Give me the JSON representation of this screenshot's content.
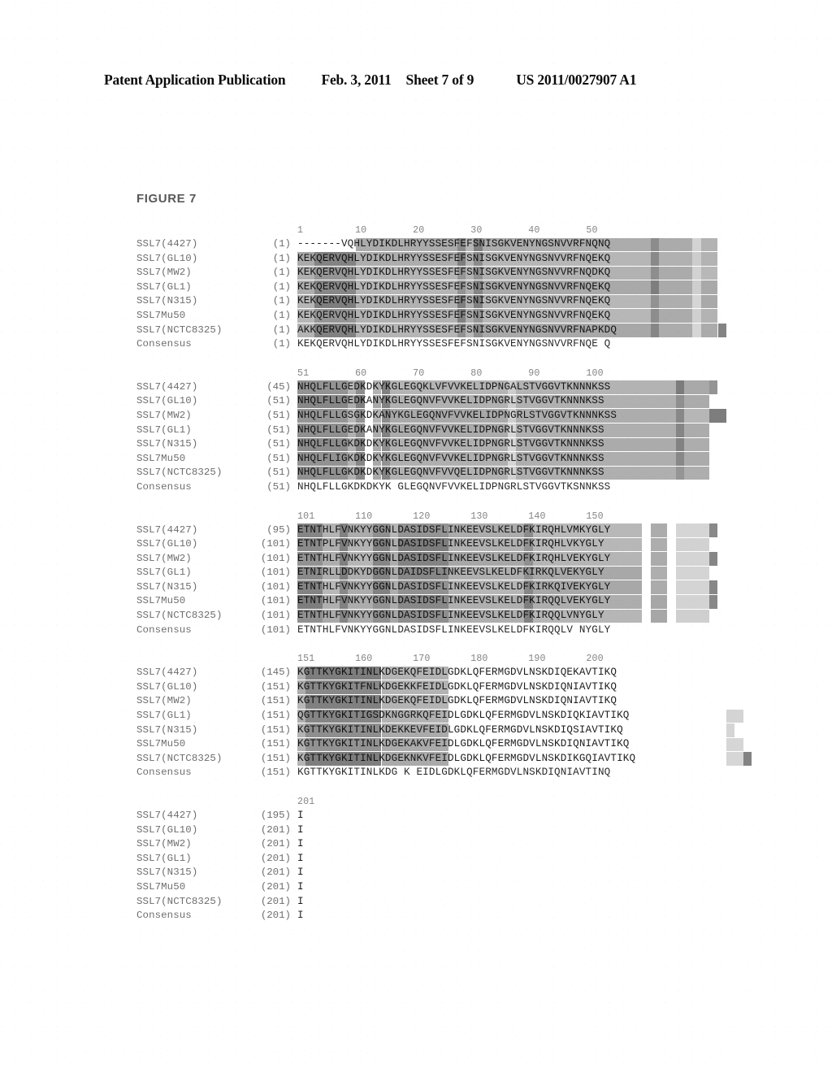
{
  "header": {
    "publication": "Patent Application Publication",
    "date": "Feb. 3, 2011",
    "sheet": "Sheet 7 of 9",
    "patent_number": "US 2011/0027907 A1"
  },
  "figure": {
    "title": "FIGURE 7",
    "row_labels": [
      "SSL7(4427)",
      "SSL7(GL10)",
      "SSL7(MW2)",
      "SSL7(GL1)",
      "SSL7(N315)",
      "SSL7Mu50",
      "SSL7(NCTC8325)",
      "Consensus"
    ],
    "blocks": [
      {
        "ruler": "1         10        20        30        40        50",
        "positions": [
          "(1)",
          "(1)",
          "(1)",
          "(1)",
          "(1)",
          "(1)",
          "(1)",
          "(1)"
        ],
        "sequences": [
          "-------VQHLYDIKDLHRYYSSESFEFSNISGKVENYNGSNVVRFNQNQ",
          "KEKQERVQHLYDIKDLHRYYSSESFEFSNISGKVENYNGSNVVRFNQEKQ",
          "KEKQERVQHLYDIKDLHRYYSSESFEFSNISGKVENYNGSNVVRFNQDKQ",
          "KEKQERVQHLYDIKDLHRYYSSESFEFSNISGKVENYNGSNVVRFNQEKQ",
          "KEKQERVQHLYDIKDLHRYYSSESFEFSNISGKVENYNGSNVVRFNQEKQ",
          "KEKQERVQHLYDIKDLHRYYSSESFEFSNISGKVENYNGSNVVRFNQEKQ",
          "AKKQERVQHLYDIKDLHRYYSSESFEFSNISGKVENYNGSNVVRFNAPKDQ",
          "KEKQERVQHLYDIKDLHRYYSSESFEFSNISGKVENYNGSNVVRFNQE Q"
        ]
      },
      {
        "ruler": "51        60        70        80        90        100",
        "positions": [
          "(45)",
          "(51)",
          "(51)",
          "(51)",
          "(51)",
          "(51)",
          "(51)",
          "(51)"
        ],
        "sequences": [
          "NHQLFLLGEDKDKYKGLEGQKLVFVVKELIDPNGALSTVGGVTKNNNKSS",
          "NHQLFLLGEDKANYKGLEGQNVFVVKELIDPNGRLSTVGGVTKNNNKSS",
          "NHQLFLLGSGKDKANYKGLEGQNVFVVKELIDPNGRLSTVGGVTKNNNKSS",
          "NHQLFLLGEDKANYKGLEGQNVFVVKELIDPNGRLSTVGGVTKNNNKSS",
          "NHQLFLLGKDKDKYKGLEGQNVFVVKELIDPNGRLSTVGGVTKNNNKSS",
          "NHQLFLIGKDKDKYKGLEGQNVFVVKELIDPNGRLSTVGGVTKNNNKSS",
          "NHQLFLLGKDKDKYKGLEGQNVFVVQELIDPNGRLSTVGGVTKNNNKSS",
          "NHQLFLLGKDKDKYK GLEGQNVFVVKELIDPNGRLSTVGGVTKSNNKSS"
        ]
      },
      {
        "ruler": "101       110       120       130       140       150",
        "positions": [
          "(95)",
          "(101)",
          "(101)",
          "(101)",
          "(101)",
          "(101)",
          "(101)",
          "(101)"
        ],
        "sequences": [
          "ETNTHLFVNKYYGGNLDASIDSFLINKEEVSLKELDFKIRQHLVMKYGLY",
          "ETNTPLFVNKYYGGNLDASIDSFLINKEEVSLKELDFKIRQHLVKYGLY",
          "ETNTHLFVNKYYGGNLDASIDSFLINKEEVSLKELDFKIRQHLVEKYGLY",
          "ETNIRLLDDKYDGGNLDAIDSFLINKEEVSLKELDFKIRKQLVEKYGLY",
          "ETNTHLFVNKYYGGNLDASIDSFLINKEEVSLKELDFKIRKQIVEKYGLY",
          "ETNTHLFVNKYYGGNLDASIDSFLINKEEVSLKELDFKIRQQLVEKYGLY",
          "ETNTHLFVNKYYGGNLDASIDSFLINKEEVSLKELDFKIRQQLVNYGLY",
          "ETNTHLFVNKYYGGNLDASIDSFLINKEEVSLKELDFKIRQQLV NYGLY"
        ]
      },
      {
        "ruler": "151       160       170       180       190       200",
        "positions": [
          "(145)",
          "(151)",
          "(151)",
          "(151)",
          "(151)",
          "(151)",
          "(151)",
          "(151)"
        ],
        "sequences": [
          "KGTTKYGKITINLKDGEKQFEIDLGDKLQFERMGDVLNSKDIQEKAVTIKQ",
          "KGTTKYGKITFNLKDGEKKFEIDLGDKLQFERMGDVLNSKDIQNIAVTIKQ",
          "KGTTKYGKITINLKDGEKQFEIDLGDKLQFERMGDVLNSKDIQNIAVTIKQ",
          "QGTTKYGKITIGSDKNGGRKQFEIDLGDKLQFERMGDVLNSKDIQKIAVTIKQ",
          "KGTTKYGKITINLKDEKKEVFEIDLGDKLQFERMGDVLNSKDIQSIAVTIKQ",
          "KGTTKYGKITINLKDGEKAKVFEIDLGDKLQFERMGDVLNSKDIQNIAVTIKQ",
          "KGTTKYGKITINLKDGEKNKVFEIDLGDKLQFERMGDVLNSKDIKGQIAVTIKQ",
          "KGTTKYGKITINLKDG K EIDLGDKLQFERMGDVLNSKDIQNIAVTINQ"
        ]
      },
      {
        "ruler": "201",
        "positions": [
          "(195)",
          "(201)",
          "(201)",
          "(201)",
          "(201)",
          "(201)",
          "(201)",
          "(201)"
        ],
        "sequences": [
          "I",
          "I",
          "I",
          "I",
          "I",
          "I",
          "I",
          "I"
        ]
      }
    ]
  },
  "shading": {
    "identical": "#6e6e6e",
    "similar": "#9e9e9e",
    "weak": "#c8c8c8",
    "none": "#ffffff"
  }
}
